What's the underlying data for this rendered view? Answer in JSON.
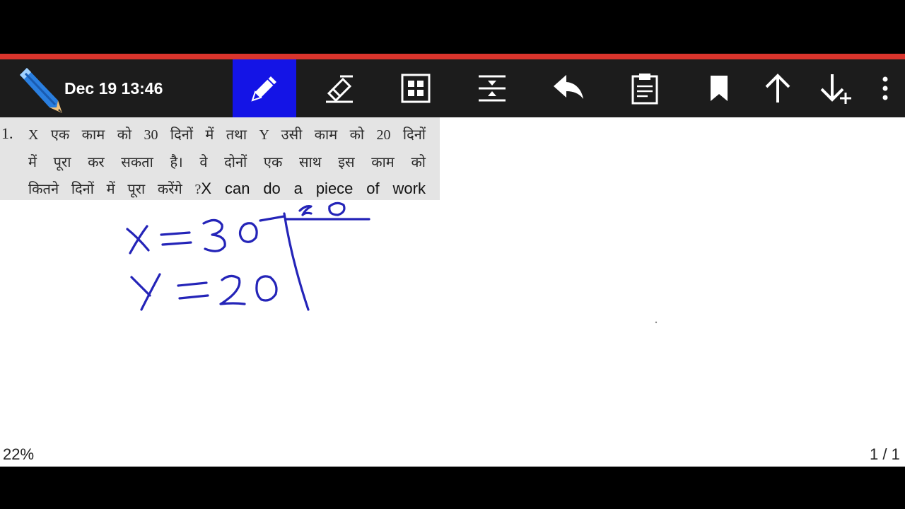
{
  "toolbar": {
    "datetime": "Dec 19 13:46",
    "tools": [
      {
        "icon": "pencil-icon",
        "active": true
      },
      {
        "icon": "eraser-icon",
        "active": false
      },
      {
        "icon": "grid-icon",
        "active": false
      },
      {
        "icon": "insert-space-icon",
        "active": false
      },
      {
        "icon": "undo-icon",
        "active": false
      },
      {
        "icon": "clipboard-icon",
        "active": false
      },
      {
        "icon": "bookmark-icon",
        "active": false
      },
      {
        "icon": "arrow-up-icon",
        "active": false
      },
      {
        "icon": "arrow-down-add-icon",
        "active": false
      },
      {
        "icon": "more-vertical-icon",
        "active": false
      }
    ],
    "colors": {
      "accent_line": "#d9342c",
      "active_tool": "#1414e6",
      "toolbar_bg": "#1c1c1c"
    }
  },
  "question": {
    "number": "1.",
    "line1": "X एक काम को 30 दिनों में तथा Y उसी काम को 20 दिनों",
    "line2": "में पूरा कर सकता है। वे दोनों एक साथ इस काम को",
    "line3_hindi": "कितने दिनों में पूरा करेंगे ?",
    "line3_english": "X can do a piece of work"
  },
  "handwriting": {
    "ink_color": "#2424b8",
    "lcm": "60",
    "line_x": "x = 30",
    "line_y": "y = 20"
  },
  "status": {
    "zoom": "22%",
    "page": "1 / 1"
  }
}
